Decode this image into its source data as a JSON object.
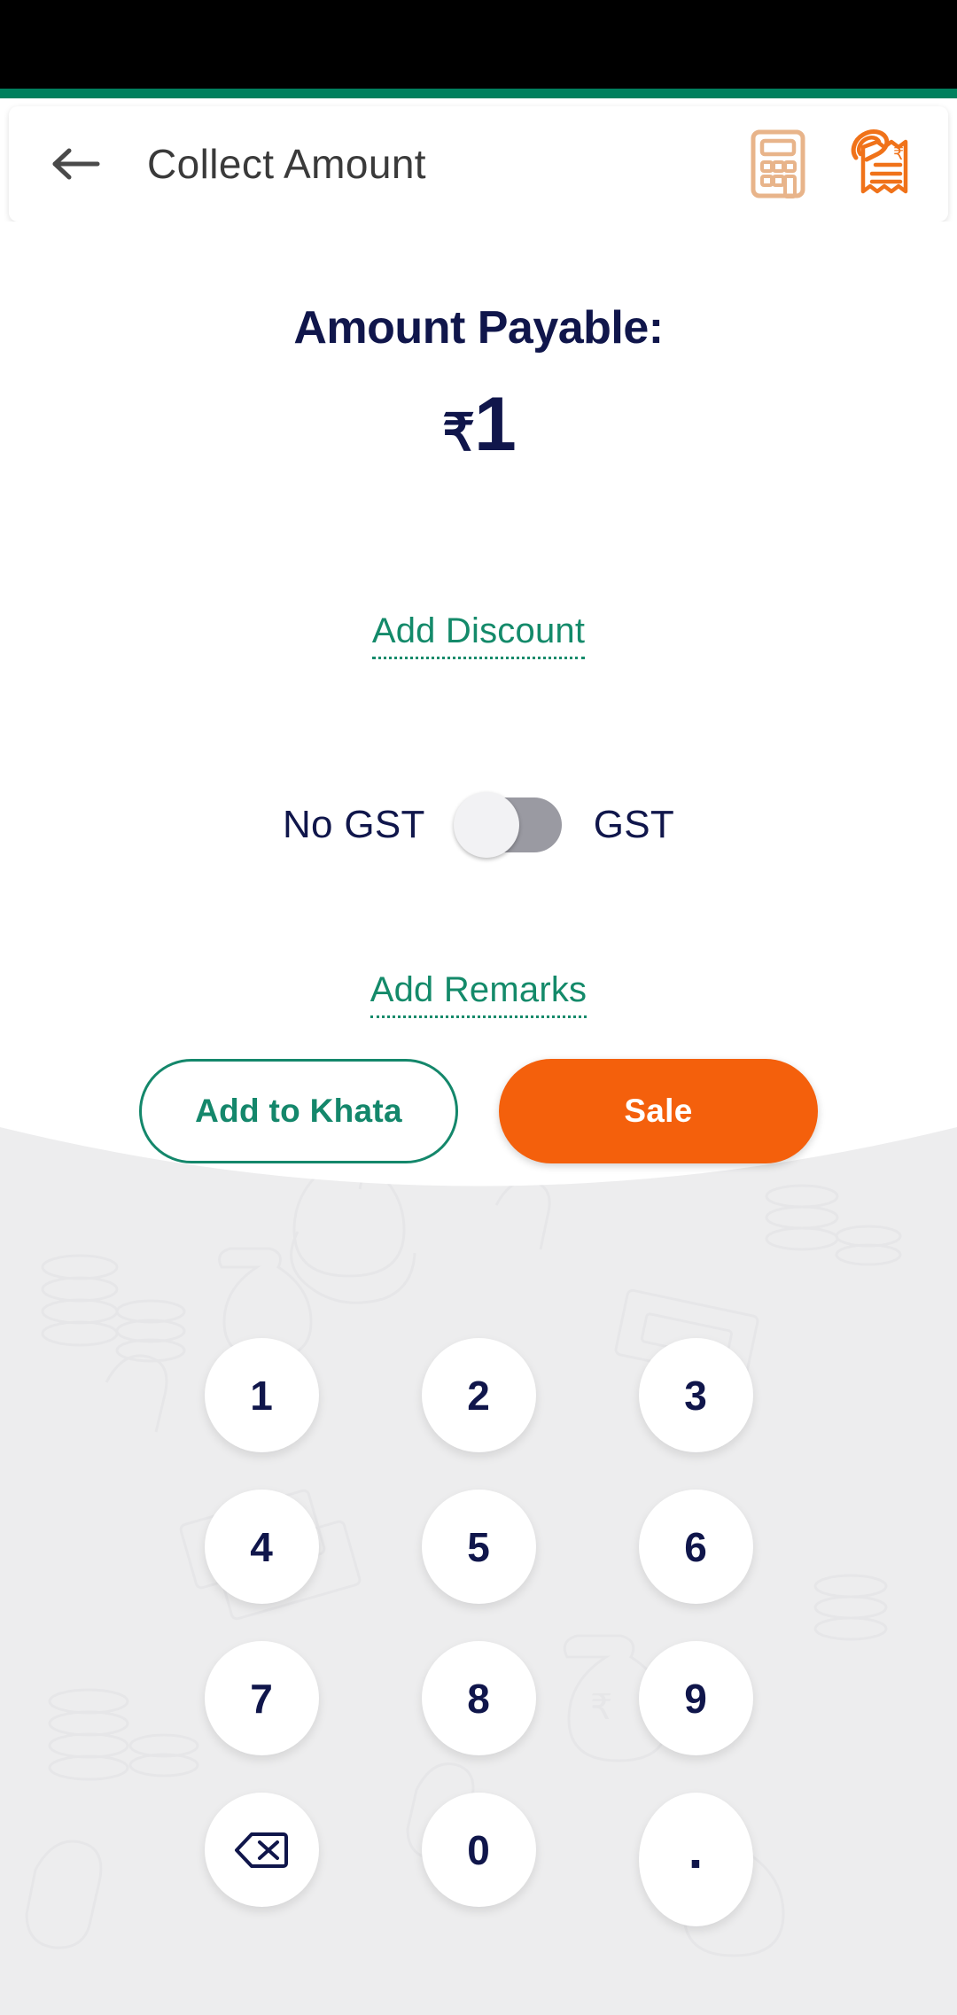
{
  "theme": {
    "status_bar_color": "#000000",
    "accent_strip_color": "#00805E",
    "navy": "#10164B",
    "teal": "#148A6A",
    "orange": "#F4600C",
    "calc_icon_color": "#E8B48A",
    "receipt_icon_color": "#F07219",
    "keypad_bg": "#EDEDEE"
  },
  "app_bar": {
    "title": "Collect Amount",
    "back_icon": "arrow-left-icon",
    "calculator_icon": "calculator-icon",
    "receipt_icon": "receipt-rupee-icon"
  },
  "amount": {
    "label": "Amount Payable:",
    "currency": "₹",
    "value": "1"
  },
  "links": {
    "add_discount": "Add Discount",
    "add_remarks": "Add Remarks"
  },
  "gst": {
    "left_label": "No GST",
    "right_label": "GST",
    "toggle_state": "off"
  },
  "actions": {
    "add_to_khata": "Add to Khata",
    "sale": "Sale"
  },
  "keypad": {
    "rows": [
      [
        "1",
        "2",
        "3"
      ],
      [
        "4",
        "5",
        "6"
      ],
      [
        "7",
        "8",
        "9"
      ],
      [
        "backspace-icon",
        "0",
        "."
      ]
    ],
    "keys": {
      "k1": "1",
      "k2": "2",
      "k3": "3",
      "k4": "4",
      "k5": "5",
      "k6": "6",
      "k7": "7",
      "k8": "8",
      "k9": "9",
      "k0": "0",
      "kdot": ".",
      "kback": "backspace-icon"
    }
  }
}
